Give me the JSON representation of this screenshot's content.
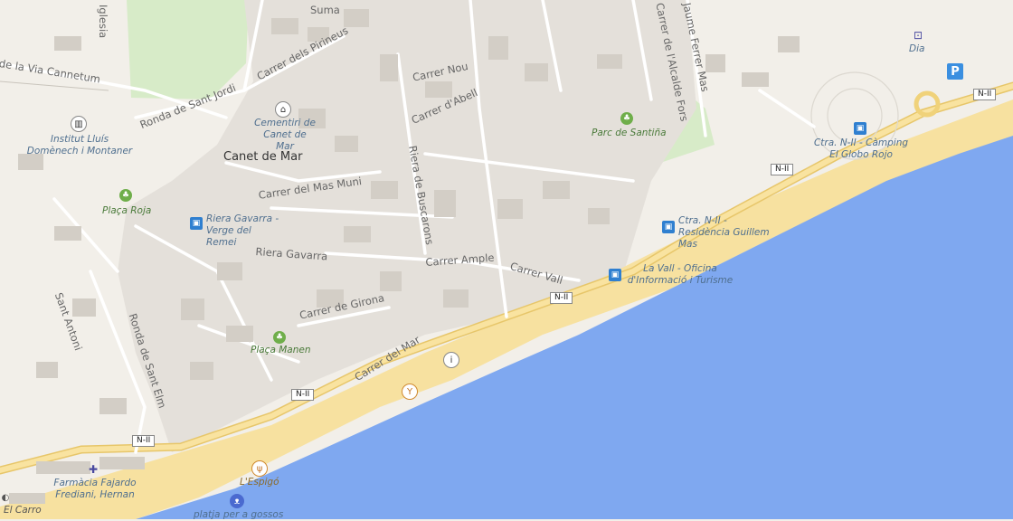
{
  "map": {
    "colors": {
      "land": "#f2efe9",
      "sea": "#7fa8f0",
      "beach": "#f7e1a0",
      "road_main": "#f6d98a",
      "park": "#d7ebc8",
      "building": "#d9d4cc"
    },
    "place_labels": {
      "town": "Canet de Mar"
    },
    "streets": {
      "via_cannetum": "de la Via Cannetum",
      "ronda_sant_jordi": "Ronda de Sant Jordi",
      "pirineus": "Carrer dels Pirineus",
      "nou": "Carrer Nou",
      "abell": "Carrer d'Abell",
      "mas_muni": "Carrer del Mas Muni",
      "riera_buscarons": "Riera de Buscarons",
      "riera_gavarra": "Riera Gavarra",
      "ample": "Carrer Ample",
      "vall": "Carrer Vall",
      "girona": "Carrer de Girona",
      "mar": "Carrer del Mar",
      "ronda_sant_elm": "Ronda de Sant Elm",
      "alcalde_fors": "Carrer de l'Alcalde Fors",
      "jaume_feliu": "Jaume Ferrer Mas",
      "sant_antoni": "Sant Antoni",
      "guardia": "Iglesia",
      "suma": "Suma"
    },
    "pois": {
      "cementiri": "Cementiri de Canet de Mar",
      "institut": "Institut Lluís Domènech i Montaner",
      "placa_roja": "Plaça Roja",
      "riera_gavarra_stop": "Riera Gavarra - Verge del Remei",
      "placa_manen": "Plaça Manen",
      "parc_santina": "Parc de Santiña",
      "ctra_camping": "Ctra. N-II - Càmping El Globo Rojo",
      "ctra_residencia": "Ctra. N-II - Residència Guillem Mas",
      "la_vall": "La Vall - Oficina d'Informació i Turisme",
      "dia": "Dia",
      "farmacia": "Farmàcia Fajardo Frediani, Hernan",
      "espigo": "L'Espigó",
      "platja_gossos": "platja per a gossos",
      "el_carro": "El Carro"
    },
    "road_shields": {
      "n2": "N-II"
    },
    "icons": {
      "bus": "bus-stop-icon",
      "parking": "P",
      "info": "i",
      "tree": "tree-icon"
    }
  }
}
